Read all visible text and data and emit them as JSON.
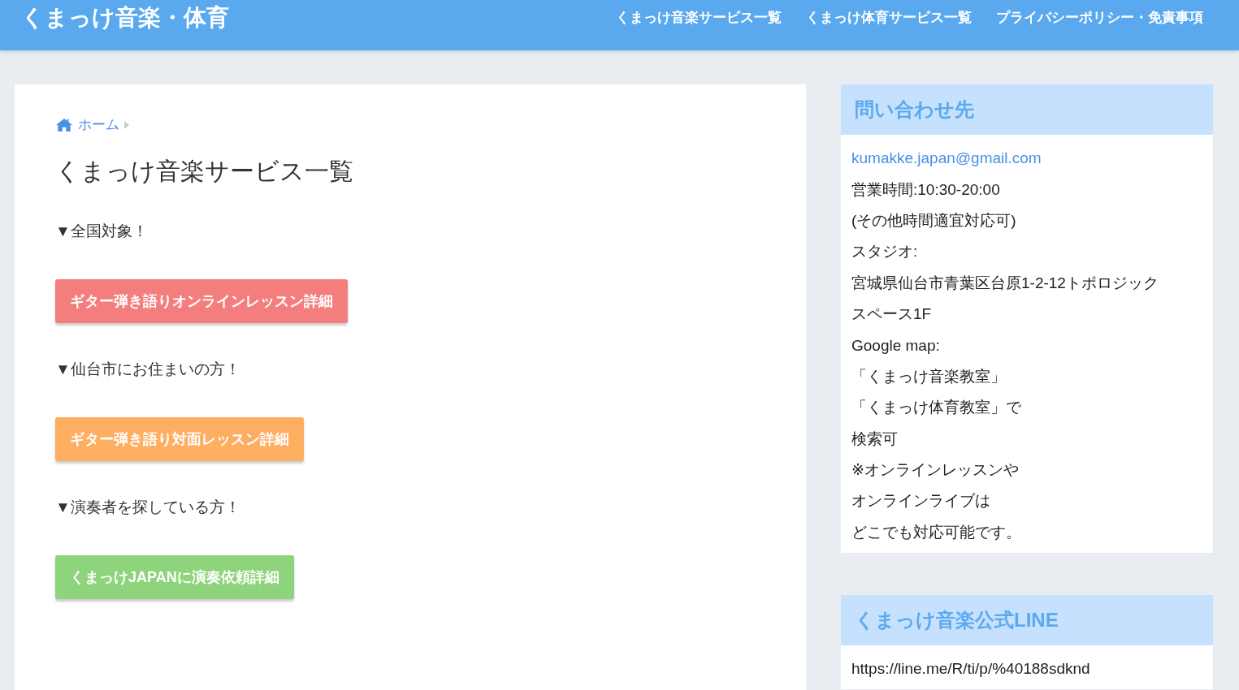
{
  "header": {
    "site_title": "くまっけ音楽・体育",
    "nav": [
      "くまっけ音楽サービス一覧",
      "くまっけ体育サービス一覧",
      "プライバシーポリシー・免責事項"
    ]
  },
  "breadcrumb": {
    "items": [
      "ホーム"
    ]
  },
  "main": {
    "title": "くまっけ音楽サービス一覧",
    "sections": [
      {
        "heading": "▼全国対象！",
        "button": {
          "label": "ギター弾き語りオンラインレッスン詳細",
          "color": "#f47d7d"
        }
      },
      {
        "heading": "▼仙台市にお住まいの方！",
        "button": {
          "label": "ギター弾き語り対面レッスン詳細",
          "color": "#fdae61"
        }
      },
      {
        "heading": "▼演奏者を探している方！",
        "button": {
          "label": "くまっけJAPANに演奏依頼詳細",
          "color": "#8ed47c"
        }
      }
    ]
  },
  "sidebar": [
    {
      "title": "問い合わせ先",
      "lines": [
        {
          "kind": "link",
          "text": "kumakke.japan@gmail.com"
        },
        {
          "kind": "text",
          "text": "営業時間:10:30-20:00"
        },
        {
          "kind": "text",
          "text": "(その他時間適宜対応可)"
        },
        {
          "kind": "text",
          "text": "スタジオ:"
        },
        {
          "kind": "text",
          "text": "宮城県仙台市青葉区台原1-2-12トポロジック"
        },
        {
          "kind": "text",
          "text": "スペース1F"
        },
        {
          "kind": "text",
          "text": "Google map:"
        },
        {
          "kind": "text",
          "text": "「くまっけ音楽教室」"
        },
        {
          "kind": "text",
          "text": "「くまっけ体育教室」で"
        },
        {
          "kind": "text",
          "text": "検索可"
        },
        {
          "kind": "text",
          "text": "※オンラインレッスンや"
        },
        {
          "kind": "text",
          "text": "オンラインライブは"
        },
        {
          "kind": "text",
          "text": "どこでも対応可能です。"
        }
      ]
    },
    {
      "title": "くまっけ音楽公式LINE",
      "lines": [
        {
          "kind": "text",
          "text": "https://line.me/R/ti/p/%40188sdknd"
        }
      ]
    }
  ]
}
